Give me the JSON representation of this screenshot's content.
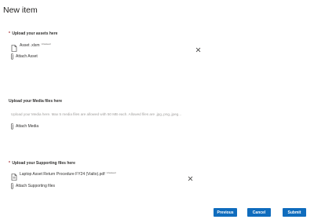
{
  "form": {
    "title": "New item"
  },
  "assets": {
    "label": "Upload your assets here",
    "required_marker": "*",
    "file": {
      "name": "Asset .xlsm",
      "tag": "Unsaved"
    },
    "attach_label": "Attach Asset"
  },
  "media": {
    "label": "Upload your Media files here",
    "placeholder": "Upload your Media here. Max 5 media files are allowed with 50 MB each. Allowed files are .jpg,.png,.jpeg...",
    "attach_label": "Attach Media"
  },
  "supporting": {
    "label": "Upload your Supporting files here",
    "required_marker": "*",
    "file": {
      "name": "Laptop Asset Return Procedure FY24 (Vialto).pdf",
      "tag": "Unsaved"
    },
    "attach_label": "Attach Supporting files"
  },
  "buttons": {
    "previous": "Previous",
    "cancel": "Cancel",
    "submit": "Submit"
  },
  "colors": {
    "primary_button": "#0f6cbd",
    "required": "#a4262c"
  },
  "icons": [
    "document-icon",
    "close-icon",
    "paperclip-icon"
  ]
}
